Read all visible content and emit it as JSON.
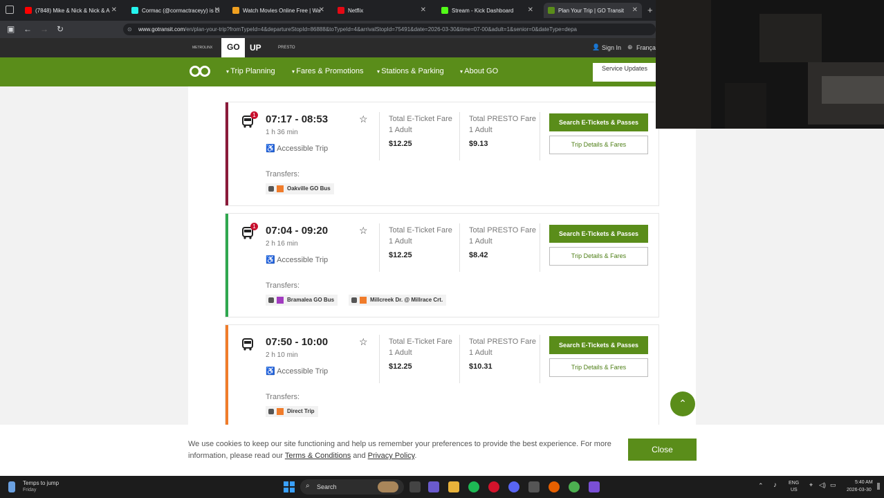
{
  "browser": {
    "tabs": [
      {
        "label": "(7848) Mike & Nick & Nick & A",
        "color": "#ff0000"
      },
      {
        "label": "Cormac (@cormactraceyy) is LI",
        "color": "#25f4ee"
      },
      {
        "label": "Watch Movies Online Free | Wa",
        "color": "#f0a020"
      },
      {
        "label": "Netflix",
        "color": "#e50914"
      },
      {
        "label": "Stream - Kick Dashboard",
        "color": "#53fc18"
      },
      {
        "label": "Plan Your Trip | GO Transit",
        "color": "#5a8d1a"
      }
    ],
    "new_tab": "+",
    "url_host": "www.gotransit.com",
    "url_path": "/en/plan-your-trip?fromTypeId=4&departureStopId=86888&toTypeId=4&arrivalStopId=75491&date=2026-03-30&time=07-00&adult=1&senior=0&dateType=depa"
  },
  "site": {
    "brands": [
      "METROLINX",
      "GO",
      "UP",
      "PRESTO"
    ],
    "sign_in": "Sign In",
    "language": "Françai",
    "nav": [
      "Trip Planning",
      "Fares & Promotions",
      "Stations & Parking",
      "About GO"
    ],
    "service_updates": "Service Updates"
  },
  "trips": [
    {
      "time": "07:17 - 08:53",
      "duration": "1 h 36 min",
      "accessible": "Accessible Trip",
      "badge": "1",
      "eticket_label": "Total E-Ticket Fare",
      "eticket_adult": "1 Adult",
      "eticket_amount": "$12.25",
      "presto_label": "Total PRESTO Fare",
      "presto_adult": "1 Adult",
      "presto_amount": "$9.13",
      "btn_search": "Search E-Tickets & Passes",
      "btn_details": "Trip Details & Fares",
      "transfers_label": "Transfers:",
      "transfers": [
        {
          "route": "",
          "text": "Oakville GO Bus"
        }
      ],
      "accent": "#8b1a3a"
    },
    {
      "time": "07:04 - 09:20",
      "duration": "2 h 16 min",
      "accessible": "Accessible Trip",
      "badge": "1",
      "eticket_label": "Total E-Ticket Fare",
      "eticket_adult": "1 Adult",
      "eticket_amount": "$12.25",
      "presto_label": "Total PRESTO Fare",
      "presto_adult": "1 Adult",
      "presto_amount": "$8.42",
      "btn_search": "Search E-Tickets & Passes",
      "btn_details": "Trip Details & Fares",
      "transfers_label": "Transfers:",
      "transfers": [
        {
          "route": "",
          "text": "Bramalea GO Bus"
        },
        {
          "route": "",
          "text": "Millcreek Dr. @ Millrace Crt."
        }
      ],
      "accent": "#2fa84f"
    },
    {
      "time": "07:50 - 10:00",
      "duration": "2 h 10 min",
      "accessible": "Accessible Trip",
      "badge": "",
      "eticket_label": "Total E-Ticket Fare",
      "eticket_adult": "1 Adult",
      "eticket_amount": "$12.25",
      "presto_label": "Total PRESTO Fare",
      "presto_adult": "1 Adult",
      "presto_amount": "$10.31",
      "btn_search": "Search E-Tickets & Passes",
      "btn_details": "Trip Details & Fares",
      "transfers_label": "Transfers:",
      "transfers": [
        {
          "route": "",
          "text": "Direct Trip"
        }
      ],
      "accent": "#f07c2b"
    }
  ],
  "cookie": {
    "text_before": "We use cookies to keep our site functioning and help us remember your preferences to provide the best experience. For more information, please read our ",
    "terms": "Terms & Conditions",
    "and": " and ",
    "privacy": "Privacy Policy",
    "end": ".",
    "close": "Close"
  },
  "taskbar": {
    "weather_line1": "Temps to jump",
    "weather_line2": "Friday",
    "search": "Search",
    "lang1": "ENG",
    "lang2": "US",
    "time": "5:40 AM",
    "date": "2026-03-30"
  }
}
